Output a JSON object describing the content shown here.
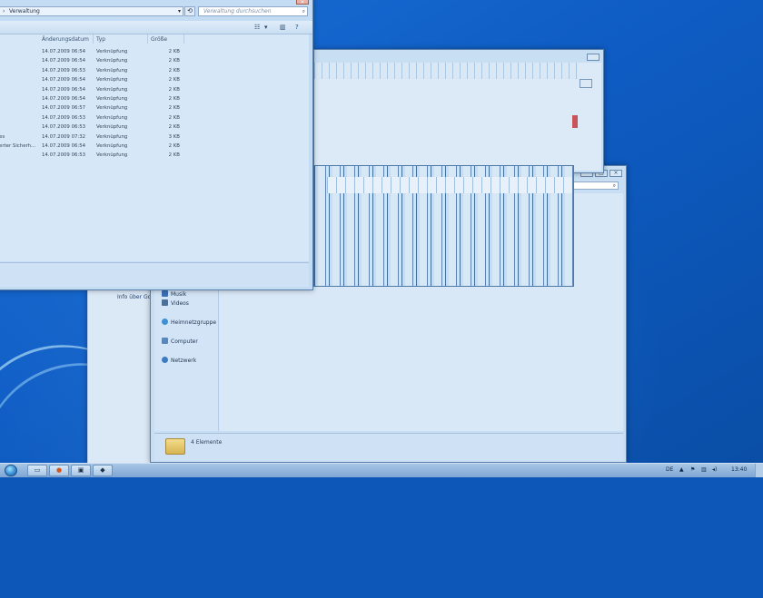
{
  "explorer": {
    "address": "Verwaltung",
    "search_placeholder": "Verwaltung durchsuchen",
    "columns": {
      "date": "Änderungsdatum",
      "type": "Typ",
      "size": "Größe"
    },
    "rows": [
      {
        "name": "",
        "date": "14.07.2009 06:54",
        "type": "Verknüpfung",
        "size": "2 KB"
      },
      {
        "name": "",
        "date": "14.07.2009 06:54",
        "type": "Verknüpfung",
        "size": "2 KB"
      },
      {
        "name": "",
        "date": "14.07.2009 06:53",
        "type": "Verknüpfung",
        "size": "2 KB"
      },
      {
        "name": "",
        "date": "14.07.2009 06:54",
        "type": "Verknüpfung",
        "size": "2 KB"
      },
      {
        "name": "",
        "date": "14.07.2009 06:54",
        "type": "Verknüpfung",
        "size": "2 KB"
      },
      {
        "name": "",
        "date": "14.07.2009 06:54",
        "type": "Verknüpfung",
        "size": "2 KB"
      },
      {
        "name": "",
        "date": "14.07.2009 06:57",
        "type": "Verknüpfung",
        "size": "2 KB"
      },
      {
        "name": "",
        "date": "14.07.2009 06:53",
        "type": "Verknüpfung",
        "size": "2 KB"
      },
      {
        "name": "",
        "date": "14.07.2009 06:53",
        "type": "Verknüpfung",
        "size": "2 KB"
      },
      {
        "name": "es",
        "date": "14.07.2009 07:32",
        "type": "Verknüpfung",
        "size": "3 KB"
      },
      {
        "name": "erter Sicherh...",
        "date": "14.07.2009 06:54",
        "type": "Verknüpfung",
        "size": "2 KB"
      },
      {
        "name": "",
        "date": "14.07.2009 06:53",
        "type": "Verknüpfung",
        "size": "2 KB"
      }
    ]
  },
  "libraries": {
    "nav": [
      {
        "label": "Musik",
        "icon": "music-icon"
      },
      {
        "label": "Videos",
        "icon": "video-icon"
      },
      {
        "label": "Heimnetzgruppe",
        "icon": "homegroup-icon"
      },
      {
        "label": "Computer",
        "icon": "computer-icon"
      },
      {
        "label": "Netzwerk",
        "icon": "network-icon"
      }
    ],
    "status_count": "4 Elemente"
  },
  "background_window": {
    "link": "Info über Go"
  },
  "taskbar": {
    "apps": [
      "explorer-icon",
      "firefox-icon",
      "monitor-icon",
      "system-icon"
    ],
    "language": "DE",
    "clock": "13:40"
  }
}
